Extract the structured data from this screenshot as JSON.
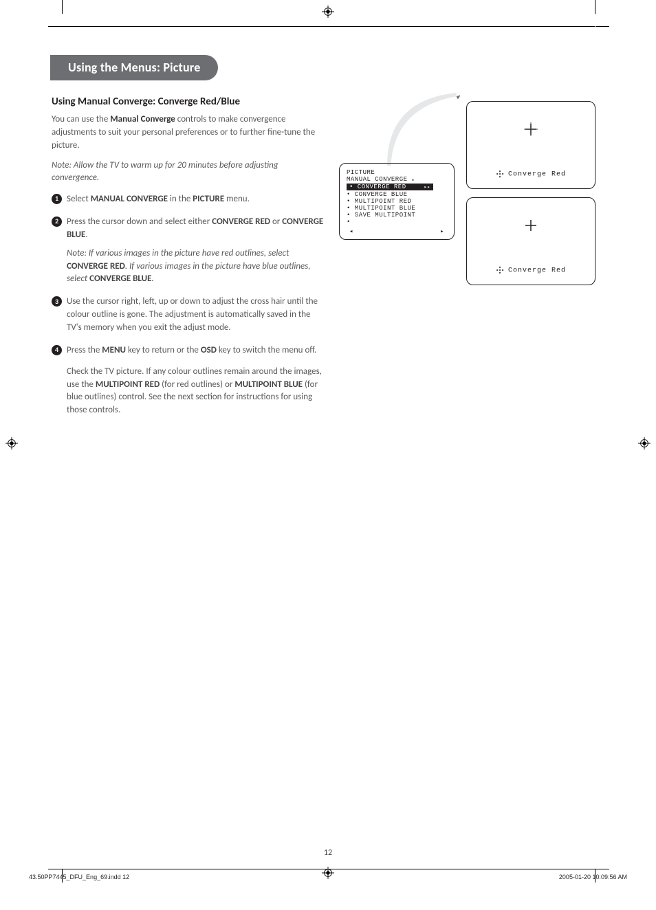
{
  "heading": "Using the Menus: Picture",
  "section_title": "Using Manual Converge: Converge Red/Blue",
  "intro_pre": "You can use the ",
  "intro_bold": "Manual Converge",
  "intro_post": " controls to make convergence adjustments to suit your personal preferences or to further fine-tune the picture.",
  "note_top": "Note: Allow the TV to warm up for 20 minutes before adjusting convergence.",
  "steps": {
    "s1_a": "Select ",
    "s1_b": "MANUAL CONVERGE",
    "s1_c": " in the ",
    "s1_d": "PICTURE",
    "s1_e": " menu.",
    "s2_a": "Press the cursor down and select either ",
    "s2_b": "CONVERGE RED",
    "s2_c": " or ",
    "s2_d": "CONVERGE BLUE",
    "s2_e": ".",
    "s2_note_a": "Note: If various images in the picture have red outlines, select ",
    "s2_note_b": "CONVERGE RED",
    "s2_note_c": ". If various images in the picture have blue outlines, select ",
    "s2_note_d": "CONVERGE BLUE",
    "s2_note_e": ".",
    "s3": "Use the cursor right, left, up or down to adjust the cross hair until the colour outline is gone. The adjustment is automatically saved in the TV's memory when you exit the adjust mode.",
    "s4_a": "Press the ",
    "s4_b": "MENU",
    "s4_c": " key to return or the ",
    "s4_d": "OSD",
    "s4_e": " key to switch the menu off.",
    "s4_p2_a": "Check the TV picture. If any colour outlines remain around the images, use the ",
    "s4_p2_b": "MULTIPOINT RED",
    "s4_p2_c": " (for red outlines) or ",
    "s4_p2_d": "MULTIPOINT BLUE",
    "s4_p2_e": " (for blue outlines) control. See the next section for instructions for using those controls."
  },
  "osd": {
    "title": "PICTURE",
    "sub": "MANUAL CONVERGE",
    "selected": "• CONVERGE RED",
    "items": [
      "• CONVERGE BLUE",
      "• MULTIPOINT RED",
      "• MULTIPOINT BLUE",
      "• SAVE MULTIPOINT",
      "•"
    ]
  },
  "tv_label": "Converge Red",
  "page_number": "12",
  "footer_left": "43.50PP7445_DFU_Eng_69.indd   12",
  "footer_right": "2005-01-20   10:09:56 AM"
}
